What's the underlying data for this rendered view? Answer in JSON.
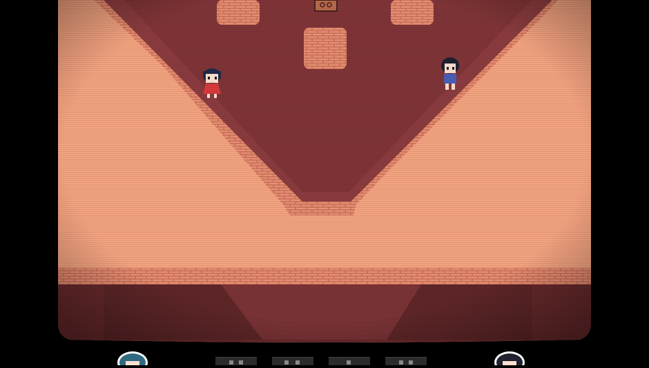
{
  "scene": {
    "name": "brick-pyramid-room",
    "palette": {
      "background": "#000000",
      "floor": "#f2a27f",
      "floor_shadow": "#c97d67",
      "pit": "#8a3b3e",
      "pit_dark": "#7a3034",
      "brick_line": "#c25f4e",
      "lower_wall": "#6a2a2c",
      "lower_wall_dark": "#5a2326"
    },
    "scanlines": true
  },
  "characters": [
    {
      "id": "girl-red-dress",
      "dress": "#d83a3a",
      "hair": "#1f2a4a"
    },
    {
      "id": "person-blue-shirt",
      "shirt": "#4a5fb8",
      "hair": "#1f2030"
    }
  ],
  "hud": {
    "slots": [
      {
        "id": "slot-1",
        "pips": 2
      },
      {
        "id": "slot-2",
        "pips": 2
      },
      {
        "id": "slot-3",
        "pips": 1
      },
      {
        "id": "slot-4",
        "pips": 2
      }
    ],
    "portraits": [
      {
        "id": "left-portrait",
        "hair": "#2f6a80"
      },
      {
        "id": "right-portrait",
        "hair": "#1f2030"
      }
    ]
  }
}
